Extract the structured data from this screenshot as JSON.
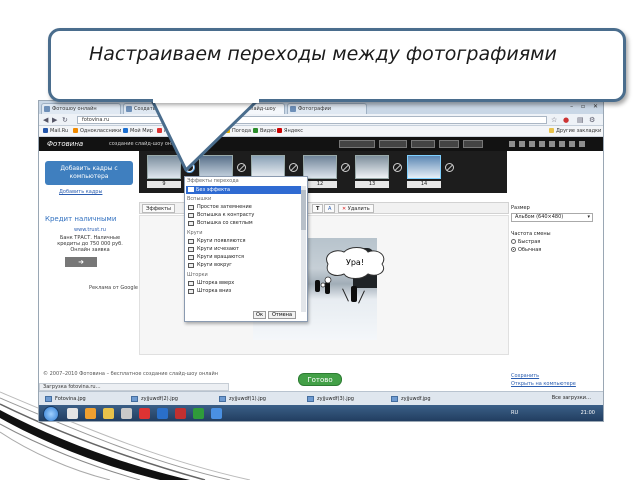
{
  "callout": {
    "text": "Настраиваем переходы между фотографиями"
  },
  "browser": {
    "tabs": [
      {
        "label": "Фотошоу онлайн"
      },
      {
        "label": "Создать фотошоу"
      },
      {
        "label": "Фотовина – слайд-шоу"
      },
      {
        "label": "Фотографии"
      }
    ],
    "url": "fotovina.ru",
    "bookmarks": [
      "Mail.Ru",
      "Одноклассники",
      "Мой Мир",
      "Новости",
      "Игры",
      "Погода",
      "Видео",
      "Яндекс"
    ],
    "bookmarks_right": "Другие закладки"
  },
  "app": {
    "logo": "Фотовина",
    "tagline": "создание слайд-шоу онлайн",
    "add_button": "Добавить кадры с компьютера",
    "add_link": "Добавить кадры",
    "thumbs": [
      {
        "num": "9"
      },
      {
        "num": "10"
      },
      {
        "num": "11"
      },
      {
        "num": "12"
      },
      {
        "num": "13"
      },
      {
        "num": "14"
      },
      {
        "num": "15"
      }
    ],
    "ad": {
      "title": "Кредит наличными",
      "lines": [
        "www.trust.ru",
        "Банк ТРАСТ. Наличные",
        "кредиты до 750 000 руб.",
        "Онлайн заявка"
      ],
      "google": "Реклама от Google"
    },
    "fx_toolbar": {
      "effects": "Эффекты",
      "text": "Т",
      "delete": "Удалить"
    },
    "photo_text": "Ура!",
    "dropdown": {
      "header": "Эффекты перехода",
      "selected": "Без эффекта",
      "groups": [
        {
          "title": "Вспышки",
          "items": [
            "Простое затемнение",
            "Вспышка к контрасту",
            "Вспышка со светлым"
          ]
        },
        {
          "title": "Круги",
          "items": [
            "Круги появляются",
            "Круги исчезают",
            "Круги вращаются",
            "Круги вокруг"
          ]
        },
        {
          "title": "Шторки",
          "items": [
            "Шторка вверх",
            "Шторка вниз"
          ]
        }
      ],
      "ok": "Ок",
      "cancel": "Отмена"
    },
    "right_panel": {
      "size_label": "Размер",
      "size_value": "Альбом (640×480)",
      "speed_label": "Частота смены",
      "radio_1": "Быстрая",
      "radio_2": "Обычная",
      "link_1": "Сохранить",
      "link_2": "Открыть на компьютере"
    },
    "done_button": "Готово",
    "footer_text": "© 2007–2010 Фотовина – бесплатное создание слайд-шоу онлайн",
    "statusbar": "Загрузка fotovina.ru…"
  },
  "downloads": [
    {
      "label": "Fotovina.jpg"
    },
    {
      "label": "zyjjuwdf(2).jpg"
    },
    {
      "label": "zyjjuwdf(1).jpg"
    },
    {
      "label": "zyjjuwdf(3).jpg"
    },
    {
      "label": "zyjjuwdf.jpg"
    }
  ],
  "downloads_all": "Все загрузки…",
  "taskbar": {
    "lang": "RU",
    "time": "21:00"
  },
  "colors": {
    "callout_border": "#4a6d8d",
    "done_button": "#43a047",
    "add_button": "#3f7fbf"
  }
}
